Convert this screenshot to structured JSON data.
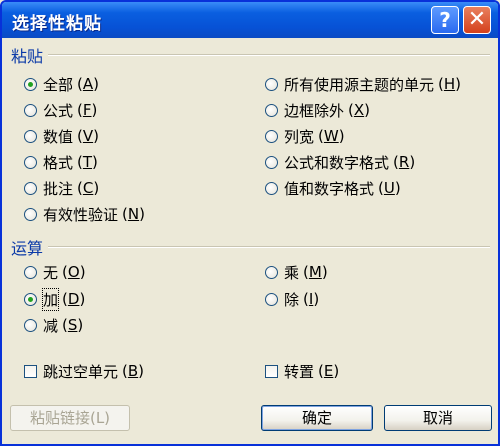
{
  "window": {
    "title": "选择性粘贴",
    "help_label": "?",
    "close_label": "✕"
  },
  "paste_section": {
    "label": "粘贴",
    "selected": "全部",
    "options": [
      {
        "label": "全部",
        "key": "A"
      },
      {
        "label": "公式",
        "key": "F"
      },
      {
        "label": "数值",
        "key": "V"
      },
      {
        "label": "格式",
        "key": "T"
      },
      {
        "label": "批注",
        "key": "C"
      },
      {
        "label": "有效性验证",
        "key": "N"
      },
      {
        "label": "所有使用源主题的单元",
        "key": "H"
      },
      {
        "label": "边框除外",
        "key": "X"
      },
      {
        "label": "列宽",
        "key": "W"
      },
      {
        "label": "公式和数字格式",
        "key": "R"
      },
      {
        "label": "值和数字格式",
        "key": "U"
      }
    ]
  },
  "operation_section": {
    "label": "运算",
    "selected": "加",
    "options": [
      {
        "label": "无",
        "key": "O"
      },
      {
        "label": "加",
        "key": "D"
      },
      {
        "label": "减",
        "key": "S"
      },
      {
        "label": "乘",
        "key": "M"
      },
      {
        "label": "除",
        "key": "I"
      }
    ]
  },
  "checkboxes": [
    {
      "label": "跳过空单元",
      "key": "B",
      "checked": false
    },
    {
      "label": "转置",
      "key": "E",
      "checked": false
    }
  ],
  "buttons": {
    "paste_link": "粘贴链接(L)",
    "ok": "确定",
    "cancel": "取消"
  }
}
